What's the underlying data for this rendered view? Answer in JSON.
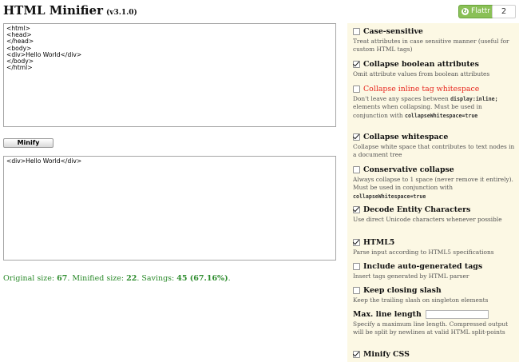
{
  "header": {
    "title": "HTML Minifier",
    "version": "(v3.1.0)"
  },
  "flattr": {
    "label": "Flattr",
    "count": "2"
  },
  "input": {
    "value": "<html>\n<head>\n</head>\n<body>\n<div>Hello World</div>\n</body>\n</html>"
  },
  "minify_button": "Minify",
  "output": {
    "value": "<div>Hello World</div>"
  },
  "stats": {
    "original_label": "Original size: ",
    "original_value": "67",
    "minified_label": ". Minified size: ",
    "minified_value": "22",
    "savings_label": ". Savings: ",
    "savings_value": "45 (67.16%)",
    "end": "."
  },
  "options": {
    "case_sensitive": {
      "label": "Case-sensitive",
      "checked": false,
      "desc": "Treat attributes in case sensitive manner (useful for custom HTML tags)"
    },
    "collapse_boolean": {
      "label": "Collapse boolean attributes",
      "checked": true,
      "desc": "Omit attribute values from boolean attributes"
    },
    "collapse_inline": {
      "label": "Collapse inline tag whitespace",
      "checked": false,
      "color": "#e8281f",
      "desc_1": "Don't leave any spaces between ",
      "desc_code1": "display:inline;",
      "desc_2": " elements when collapsing. Must be used in conjunction with ",
      "desc_code2": "collapseWhitespace=true"
    },
    "collapse_whitespace": {
      "label": "Collapse whitespace",
      "checked": true,
      "desc": "Collapse white space that contributes to text nodes in a document tree"
    },
    "conservative_collapse": {
      "label": "Conservative collapse",
      "checked": false,
      "desc_1": "Always collapse to 1 space (never remove it entirely). Must be used in conjunction with ",
      "desc_code": "collapseWhitespace=true"
    },
    "decode_entities": {
      "label": "Decode Entity Characters",
      "checked": true,
      "desc": "Use direct Unicode characters whenever possible"
    },
    "html5": {
      "label": "HTML5",
      "checked": true,
      "desc": "Parse input according to HTML5 specifications"
    },
    "include_auto": {
      "label": "Include auto-generated tags",
      "checked": false,
      "desc": "Insert tags generated by HTML parser"
    },
    "keep_slash": {
      "label": "Keep closing slash",
      "checked": false,
      "desc": "Keep the trailing slash on singleton elements"
    },
    "max_line_length": {
      "label": "Max. line length",
      "value": "",
      "desc": "Specify a maximum line length. Compressed output will be split by newlines at valid HTML split-points"
    },
    "minify_css": {
      "label": "Minify CSS",
      "checked": true
    }
  },
  "colors": {
    "accent_green": "#2a8a2a",
    "panel_bg": "#fcf8e4",
    "flattr_green": "#8ac056",
    "warn_red": "#e8281f"
  }
}
